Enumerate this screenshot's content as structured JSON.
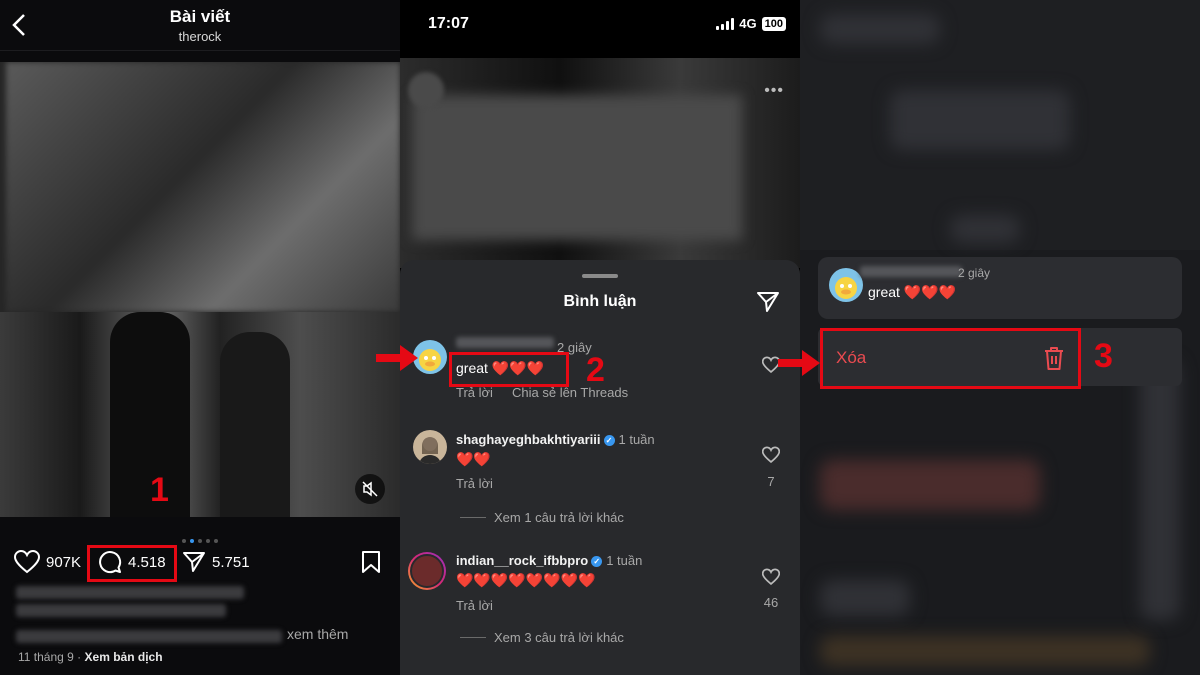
{
  "panel1": {
    "header_title": "Bài viết",
    "header_subtitle": "therock",
    "likes": "907K",
    "comments": "4.518",
    "shares": "5.751",
    "see_more": "xem thêm",
    "date": "11 tháng 9",
    "separator": "·",
    "translate": "Xem bản dịch",
    "carousel_dots": 5,
    "carousel_active": 1
  },
  "panel2": {
    "time": "17:07",
    "network": "4G",
    "battery": "100",
    "sheet_title": "Bình luận",
    "comments": [
      {
        "username": "",
        "age": "2 giây",
        "text": "great ❤️❤️❤️",
        "reply": "Trả lời",
        "share": "Chia sẻ lên Threads",
        "likes": ""
      },
      {
        "username": "shaghayeghbakhtiyariii",
        "age": "1 tuần",
        "text": "❤️❤️",
        "reply": "Trả lời",
        "likes": "7",
        "more_replies": "Xem 1 câu trả lời khác"
      },
      {
        "username": "indian__rock_ifbbpro",
        "age": "1 tuần",
        "text": "❤️❤️❤️❤️❤️❤️❤️❤️",
        "reply": "Trả lời",
        "likes": "46",
        "more_replies": "Xem 3 câu trả lời khác"
      }
    ]
  },
  "panel3": {
    "comment_age": "2 giây",
    "comment_text": "great ❤️❤️❤️",
    "delete_label": "Xóa"
  },
  "steps": [
    "1",
    "2",
    "3"
  ],
  "colors": {
    "highlight": "#e50914",
    "delete": "#ea4b50",
    "verified": "#3897f0"
  }
}
